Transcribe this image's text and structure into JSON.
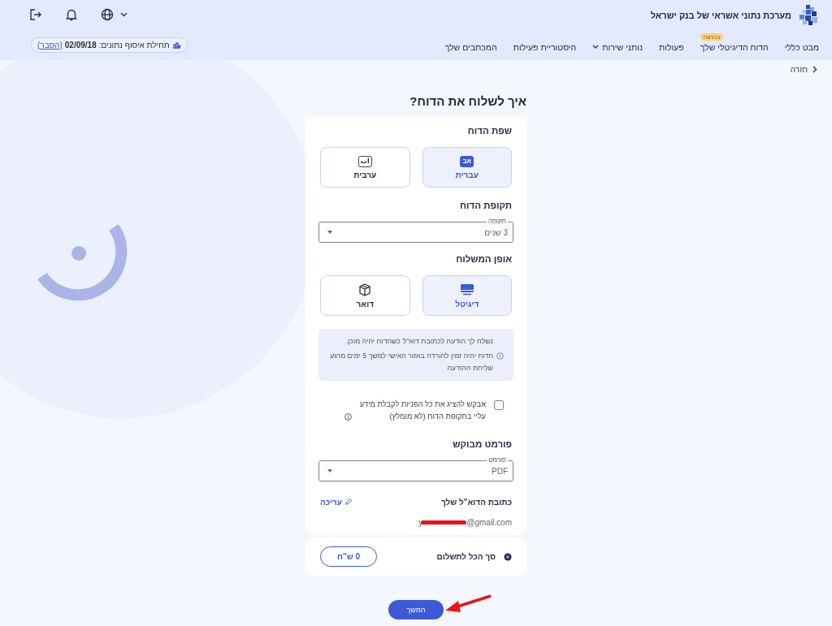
{
  "header": {
    "title": "מערכת נתוני אשראי של בנק ישראל"
  },
  "nav": {
    "items": [
      {
        "label": "מבט כללי",
        "selected": false,
        "has_menu": false
      },
      {
        "label": "הדוח הדיגיטלי שלך",
        "selected": false,
        "has_menu": false,
        "badge": "בהרצה"
      },
      {
        "label": "פעולות",
        "selected": false,
        "has_menu": false
      },
      {
        "label": "נותני שירות",
        "selected": false,
        "has_menu": true
      },
      {
        "label": "היסטוריית פעילות",
        "selected": false,
        "has_menu": false
      },
      {
        "label": "המכתבים שלך",
        "selected": false,
        "has_menu": false
      }
    ],
    "data_start": {
      "label": "תחילת איסוף נתונים:",
      "date": "02/09/18",
      "link": "(הסבר)"
    }
  },
  "back": "חזרה",
  "page_title": "איך לשלוח את הדוח?",
  "language": {
    "title": "שפת הדוח",
    "options": [
      {
        "label": "עברית",
        "glyph": "אב",
        "selected": true
      },
      {
        "label": "ערבית",
        "glyph": "اب",
        "selected": false
      }
    ]
  },
  "period": {
    "title": "תקופת הדוח",
    "field_label": "תקופה",
    "value": "3 שנים"
  },
  "delivery": {
    "title": "אופן המשלוח",
    "options": [
      {
        "label": "דיגיטל",
        "kind": "screen",
        "selected": true
      },
      {
        "label": "דואר",
        "kind": "box",
        "selected": false
      }
    ]
  },
  "notice": {
    "lines": [
      "נשלח לך הודעה לכתובת דוא\"ל כשהדוח יהיה מוכן.",
      "הדוח יהיה זמין להורדה באזור האישי למשך 5 ימים מרגע שליחת ההודעה"
    ]
  },
  "consent": {
    "label": "אבקש להציג את כל הפניות לקבלת מידע עליי בתקופת הדוח (לא מומלץ)",
    "checked": false
  },
  "format": {
    "title": "פורמט מבוקש",
    "field_label": "פורמט",
    "value": "PDF"
  },
  "email": {
    "title": "כתובת הדוא\"ל שלך",
    "edit": "עריכה",
    "prefix": "y",
    "suffix": "@gmail.com"
  },
  "total": {
    "label": "סך הכל לתשלום",
    "amount": "0 ש\"ח"
  },
  "continue": "המשך"
}
